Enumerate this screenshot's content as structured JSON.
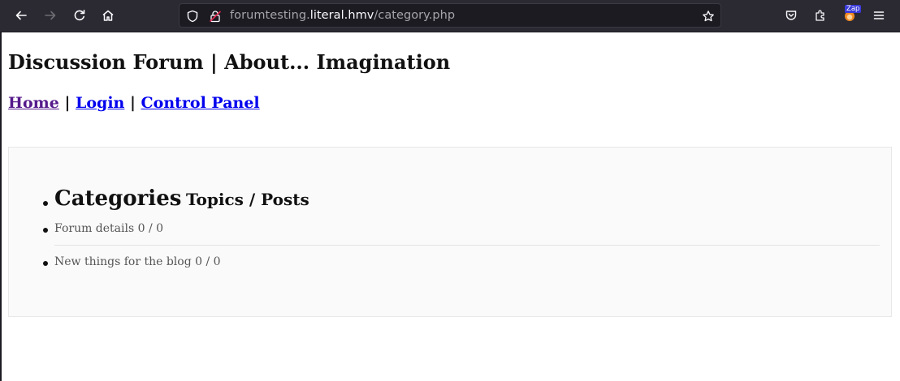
{
  "browser": {
    "url_prefix": "forumtesting.",
    "url_host": "literal.hmv",
    "url_path": "/category.php",
    "extension_badge": "Zap",
    "icons": {
      "back": "arrow-left-icon",
      "forward": "arrow-right-icon",
      "reload": "reload-icon",
      "home": "home-icon",
      "shield": "shield-icon",
      "lock": "insecure-lock-icon",
      "bookmark": "star-icon",
      "pocket": "pocket-icon",
      "extensions": "puzzle-icon",
      "menu": "hamburger-icon"
    }
  },
  "site": {
    "title": "Discussion Forum | About... Imagination",
    "menu": {
      "home": "Home",
      "login": "Login",
      "control_panel": "Control Panel",
      "separator": "|"
    }
  },
  "categories": {
    "header_main": "Categories",
    "header_sub": "Topics / Posts",
    "rows": [
      {
        "label": "Forum details 0 / 0"
      },
      {
        "label": "New things for the blog 0 / 0"
      }
    ]
  },
  "colors": {
    "toolbar": "#2b2a33",
    "visited_link": "#551a8b",
    "link": "#0000ee"
  }
}
